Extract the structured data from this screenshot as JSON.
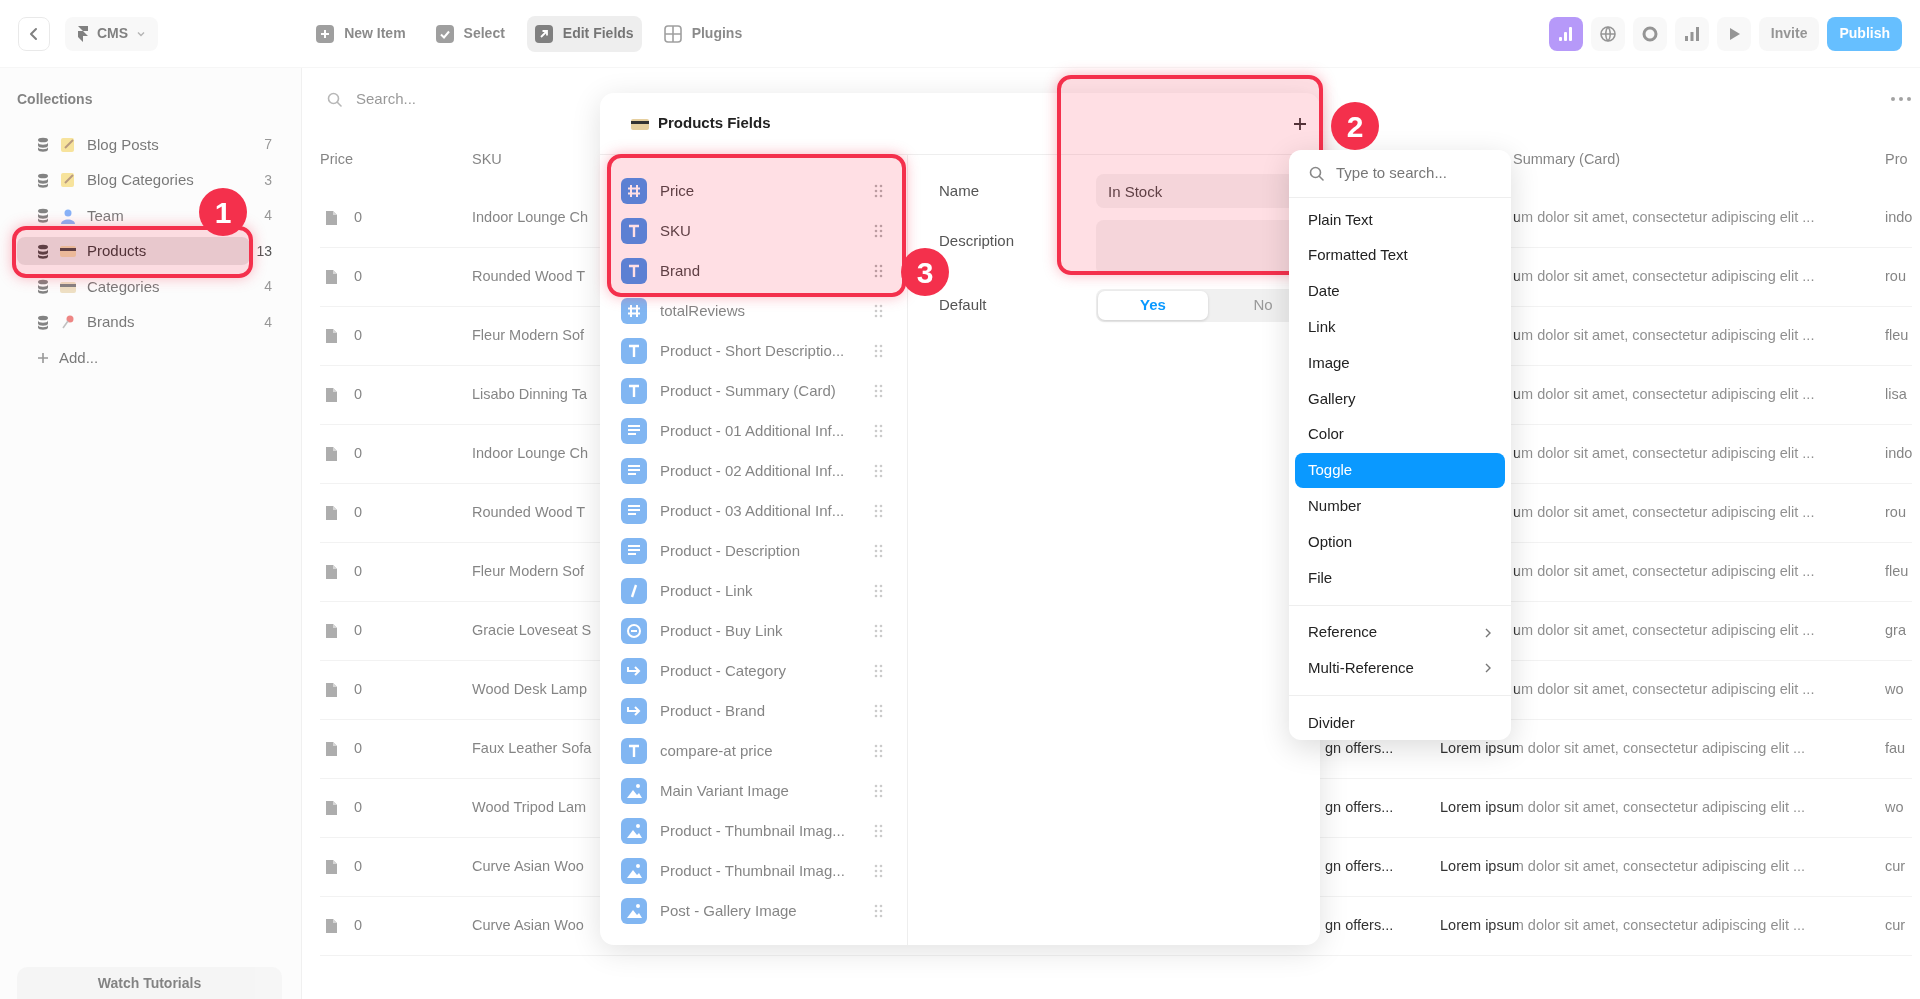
{
  "top_bar": {
    "cms_label": "CMS",
    "toolbar": [
      {
        "label": "New Item",
        "selected": false
      },
      {
        "label": "Select",
        "selected": false
      },
      {
        "label": "Edit Fields",
        "selected": true
      },
      {
        "label": "Plugins",
        "selected": false
      }
    ],
    "invite": "Invite",
    "publish": "Publish"
  },
  "sidebar": {
    "heading": "Collections",
    "items": [
      {
        "label": "Blog Posts",
        "count": "7",
        "selected": false,
        "highlighted": false
      },
      {
        "label": "Blog Categories",
        "count": "3",
        "selected": false,
        "highlighted": false
      },
      {
        "label": "Team",
        "count": "4",
        "selected": false,
        "highlighted": false
      },
      {
        "label": "Products",
        "count": "13",
        "selected": true,
        "highlighted": true
      },
      {
        "label": "Categories",
        "count": "4",
        "selected": false,
        "highlighted": false
      },
      {
        "label": "Brands",
        "count": "4",
        "selected": false,
        "highlighted": false
      }
    ],
    "add_label": "Add...",
    "tutorials_button": "Watch Tutorials"
  },
  "table": {
    "search_placeholder": "Search...",
    "columns": [
      "Price",
      "SKU",
      "Summary (Card)",
      "Pro"
    ],
    "rows": [
      {
        "price": "0",
        "sku": "Indoor Lounge Ch",
        "summary": "um dolor sit amet, consectetur adipiscing elit ...",
        "column_5": "indo"
      },
      {
        "price": "0",
        "sku": "Rounded Wood T",
        "summary": "um dolor sit amet, consectetur adipiscing elit ...",
        "column_5": "rou"
      },
      {
        "price": "0",
        "sku": "Fleur Modern Sof",
        "summary": "um dolor sit amet, consectetur adipiscing elit ...",
        "column_5": "fleu"
      },
      {
        "price": "0",
        "sku": "Lisabo Dinning Ta",
        "summary": "um dolor sit amet, consectetur adipiscing elit ...",
        "column_5": "lisa"
      },
      {
        "price": "0",
        "sku": "Indoor Lounge Ch",
        "summary": "um dolor sit amet, consectetur adipiscing elit ...",
        "column_5": "indo"
      },
      {
        "price": "0",
        "sku": "Rounded Wood T",
        "summary": "um dolor sit amet, consectetur adipiscing elit ...",
        "column_5": "rou"
      },
      {
        "price": "0",
        "sku": "Fleur Modern Sof",
        "summary": "um dolor sit amet, consectetur adipiscing elit ...",
        "column_5": "fleu"
      },
      {
        "price": "0",
        "sku": "Gracie Loveseat S",
        "summary": "um dolor sit amet, consectetur adipiscing elit ...",
        "column_5": "gra"
      },
      {
        "price": "0",
        "sku": "Wood Desk Lamp",
        "summary": "um dolor sit amet, consectetur adipiscing elit ...",
        "column_5": "wo"
      },
      {
        "price": "0",
        "sku": "Faux Leather Sofa",
        "column_3": "gn offers...",
        "summary": "Lorem ipsum dolor sit amet, consectetur adipiscing elit ...",
        "column_5": "fau"
      },
      {
        "price": "0",
        "sku": "Wood Tripod Lam",
        "column_3": "gn offers...",
        "summary": "Lorem ipsum dolor sit amet, consectetur adipiscing elit ...",
        "column_5": "wo"
      },
      {
        "price": "0",
        "sku": "Curve Asian Woo",
        "column_3": "gn offers...",
        "summary": "Lorem ipsum dolor sit amet, consectetur adipiscing elit ...",
        "column_5": "cur"
      },
      {
        "price": "0",
        "sku": "Curve Asian Woo",
        "column_3": "gn offers...",
        "summary": "Lorem ipsum dolor sit amet, consectetur adipiscing elit ...",
        "column_5": "cur"
      }
    ]
  },
  "modal": {
    "title": "Products Fields",
    "fields": [
      {
        "label": "Price",
        "kind": "number",
        "highlighted": true
      },
      {
        "label": "SKU",
        "kind": "text",
        "highlighted": true
      },
      {
        "label": "Brand",
        "kind": "text",
        "highlighted": true
      },
      {
        "label": "totalReviews",
        "kind": "number",
        "highlighted": false
      },
      {
        "label": "Product - Short Descriptio...",
        "kind": "text",
        "highlighted": false
      },
      {
        "label": "Product - Summary (Card)",
        "kind": "text",
        "highlighted": false
      },
      {
        "label": "Product - 01 Additional Inf...",
        "kind": "formatted",
        "highlighted": false
      },
      {
        "label": "Product - 02 Additional Inf...",
        "kind": "formatted",
        "highlighted": false
      },
      {
        "label": "Product - 03 Additional Inf...",
        "kind": "formatted",
        "highlighted": false
      },
      {
        "label": "Product - Description",
        "kind": "formatted",
        "highlighted": false
      },
      {
        "label": "Product - Link",
        "kind": "link",
        "highlighted": false
      },
      {
        "label": "Product - Buy Link",
        "kind": "weblink",
        "highlighted": false
      },
      {
        "label": "Product - Category",
        "kind": "reference",
        "highlighted": false
      },
      {
        "label": "Product - Brand",
        "kind": "reference",
        "highlighted": false
      },
      {
        "label": "compare-at price",
        "kind": "text",
        "highlighted": false
      },
      {
        "label": "Main Variant Image",
        "kind": "image",
        "highlighted": false
      },
      {
        "label": "Product - Thumbnail Imag...",
        "kind": "image",
        "highlighted": false
      },
      {
        "label": "Product - Thumbnail Imag...",
        "kind": "image",
        "highlighted": false
      },
      {
        "label": "Post - Gallery Image",
        "kind": "image",
        "highlighted": false
      }
    ],
    "name_label": "Name",
    "name_value": "In Stock",
    "description_label": "Description",
    "default_label": "Default",
    "default_options": [
      {
        "label": "Yes",
        "selected": true
      },
      {
        "label": "No",
        "selected": false
      }
    ]
  },
  "type_menu": {
    "search_placeholder": "Type to search...",
    "groups": [
      [
        {
          "label": "Plain Text",
          "selected": false,
          "has_submenu": false
        },
        {
          "label": "Formatted Text",
          "selected": false,
          "has_submenu": false
        },
        {
          "label": "Date",
          "selected": false,
          "has_submenu": false
        },
        {
          "label": "Link",
          "selected": false,
          "has_submenu": false
        },
        {
          "label": "Image",
          "selected": false,
          "has_submenu": false
        },
        {
          "label": "Gallery",
          "selected": false,
          "has_submenu": false
        },
        {
          "label": "Color",
          "selected": false,
          "has_submenu": false
        },
        {
          "label": "Toggle",
          "selected": true,
          "has_submenu": false
        },
        {
          "label": "Number",
          "selected": false,
          "has_submenu": false
        },
        {
          "label": "Option",
          "selected": false,
          "has_submenu": false
        },
        {
          "label": "File",
          "selected": false,
          "has_submenu": false
        }
      ],
      [
        {
          "label": "Reference",
          "selected": false,
          "has_submenu": true
        },
        {
          "label": "Multi-Reference",
          "selected": false,
          "has_submenu": true
        }
      ],
      [
        {
          "label": "Divider",
          "selected": false,
          "has_submenu": false
        }
      ]
    ]
  },
  "annotations": [
    {
      "number": "1"
    },
    {
      "number": "2"
    },
    {
      "number": "3"
    }
  ]
}
